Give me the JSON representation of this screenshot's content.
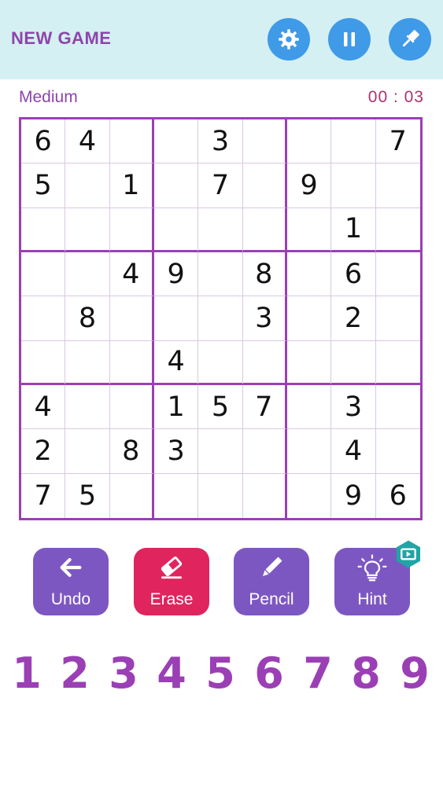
{
  "header": {
    "new_game_label": "NEW GAME"
  },
  "status": {
    "difficulty": "Medium",
    "timer": "00 : 03"
  },
  "board": {
    "rows": [
      [
        "6",
        "4",
        "",
        "",
        "3",
        "",
        "",
        "",
        "7"
      ],
      [
        "5",
        "",
        "1",
        "",
        "7",
        "",
        "9",
        "",
        ""
      ],
      [
        "",
        "",
        "",
        "",
        "",
        "",
        "",
        "1",
        ""
      ],
      [
        "",
        "",
        "4",
        "9",
        "",
        "8",
        "",
        "6",
        ""
      ],
      [
        "",
        "8",
        "",
        "",
        "",
        "3",
        "",
        "2",
        ""
      ],
      [
        "",
        "",
        "",
        "4",
        "",
        "",
        "",
        "",
        ""
      ],
      [
        "4",
        "",
        "",
        "1",
        "5",
        "7",
        "",
        "3",
        ""
      ],
      [
        "2",
        "",
        "8",
        "3",
        "",
        "",
        "",
        "4",
        ""
      ],
      [
        "7",
        "5",
        "",
        "",
        "",
        "",
        "",
        "9",
        "6"
      ]
    ]
  },
  "tools": {
    "undo_label": "Undo",
    "erase_label": "Erase",
    "pencil_label": "Pencil",
    "hint_label": "Hint"
  },
  "numpad": [
    "1",
    "2",
    "3",
    "4",
    "5",
    "6",
    "7",
    "8",
    "9"
  ],
  "colors": {
    "header_bg": "#d4f0f2",
    "accent_purple": "#9b3fb5",
    "button_blue": "#3f9ae8",
    "tool_purple": "#7d57c1",
    "erase_pink": "#e0245e",
    "badge_teal": "#1fa5a5"
  },
  "icons": {
    "settings": "gear-icon",
    "pause": "pause-icon",
    "theme": "paint-brush-icon",
    "undo": "arrow-left-icon",
    "erase": "eraser-icon",
    "pencil": "pencil-icon",
    "hint": "lightbulb-icon",
    "video": "video-play-icon"
  }
}
